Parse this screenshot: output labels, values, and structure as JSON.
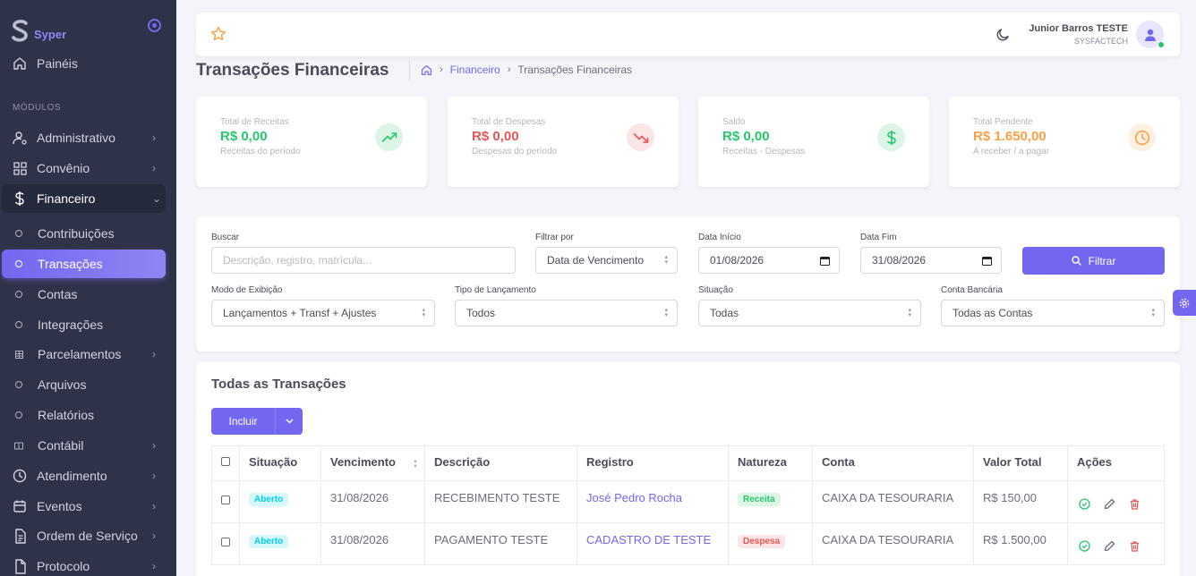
{
  "sidebar": {
    "brand": "Syper",
    "dashboard_label": "Painéis",
    "section_label": "MÓDULOS",
    "items": [
      {
        "label": "Administrativo",
        "icon": "user-cog-icon"
      },
      {
        "label": "Convênio",
        "icon": "grid-icon"
      },
      {
        "label": "Financeiro",
        "icon": "dollar-icon"
      },
      {
        "label": "Contribuições"
      },
      {
        "label": "Transações"
      },
      {
        "label": "Contas"
      },
      {
        "label": "Integrações"
      },
      {
        "label": "Parcelamentos"
      },
      {
        "label": "Arquivos"
      },
      {
        "label": "Relatórios"
      },
      {
        "label": "Contábil"
      },
      {
        "label": "Atendimento",
        "icon": "clock-icon"
      },
      {
        "label": "Eventos",
        "icon": "calendar-icon"
      },
      {
        "label": "Ordem de Serviço",
        "icon": "clipboard-icon"
      },
      {
        "label": "Protocolo",
        "icon": "file-icon"
      }
    ]
  },
  "navbar": {
    "user_name": "Junior Barros TESTE",
    "user_org": "SYSFACTECH"
  },
  "page": {
    "title": "Transações Financeiras",
    "breadcrumb": [
      "Financeiro",
      "Transações Financeiras"
    ]
  },
  "stats": [
    {
      "label": "Total de Receitas",
      "value": "R$ 0,00",
      "sub": "Receitas do período",
      "color": "#28c76f",
      "icon": "trending-up-icon"
    },
    {
      "label": "Total de Despesas",
      "value": "R$ 0,00",
      "sub": "Despesas do período",
      "color": "#ea5455",
      "icon": "trending-down-icon"
    },
    {
      "label": "Saldo",
      "value": "R$ 0,00",
      "sub": "Receitas - Despesas",
      "color": "#28c76f",
      "icon": "dollar-icon"
    },
    {
      "label": "Total Pendente",
      "value": "R$ 1.650,00",
      "sub": "A receber / a pagar",
      "color": "#ff9f43",
      "icon": "clock-icon"
    }
  ],
  "filters": {
    "search_label": "Buscar",
    "search_placeholder": "Descrição, registro, matrícula...",
    "filter_by_label": "Filtrar por",
    "filter_by_value": "Data de Vencimento",
    "start_label": "Data Início",
    "start_value": "01/08/2026",
    "end_label": "Data Fim",
    "end_value": "31/08/2026",
    "filter_button": "Filtrar",
    "mode_label": "Modo de Exibição",
    "mode_value": "Lançamentos + Transf + Ajustes",
    "type_label": "Tipo de Lançamento",
    "type_value": "Todos",
    "status_label": "Situação",
    "status_value": "Todas",
    "account_label": "Conta Bancária",
    "account_value": "Todas as Contas"
  },
  "transactions": {
    "title": "Todas as Transações",
    "add_button": "Incluir",
    "columns": [
      "Situação",
      "Vencimento",
      "Descrição",
      "Registro",
      "Natureza",
      "Conta",
      "Valor Total",
      "Ações"
    ],
    "rows": [
      {
        "status": "Aberto",
        "due": "31/08/2026",
        "description": "RECEBIMENTO TESTE",
        "registry": "José Pedro Rocha",
        "nature": "Receita",
        "account": "CAIXA DA TESOURARIA",
        "total": "R$ 150,00"
      },
      {
        "status": "Aberto",
        "due": "31/08/2026",
        "description": "PAGAMENTO TESTE",
        "registry": "CADASTRO DE TESTE",
        "nature": "Despesa",
        "account": "CAIXA DA TESOURARIA",
        "total": "R$ 1.500,00"
      }
    ]
  },
  "colors": {
    "primary": "#7367f0",
    "sidebar_bg": "#2f3349",
    "success": "#28c76f",
    "danger": "#ea5455",
    "warning": "#ff9f43",
    "info": "#00cfe8"
  }
}
